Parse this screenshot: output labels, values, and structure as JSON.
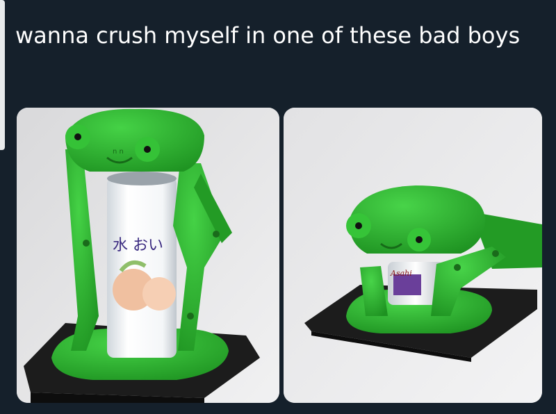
{
  "post": {
    "caption": "wanna crush myself in one of these bad boys"
  },
  "photos": [
    {
      "subject": "green-frog-can-crusher-open",
      "can_label": "水 おい"
    },
    {
      "subject": "green-frog-can-crusher-closed",
      "can_label": "Asahi"
    }
  ],
  "colors": {
    "background": "#15202b",
    "text": "#ffffff",
    "frog_green": "#2fb531",
    "frog_dark_green": "#1f8a22",
    "base_plate": "#1a1a1a"
  }
}
